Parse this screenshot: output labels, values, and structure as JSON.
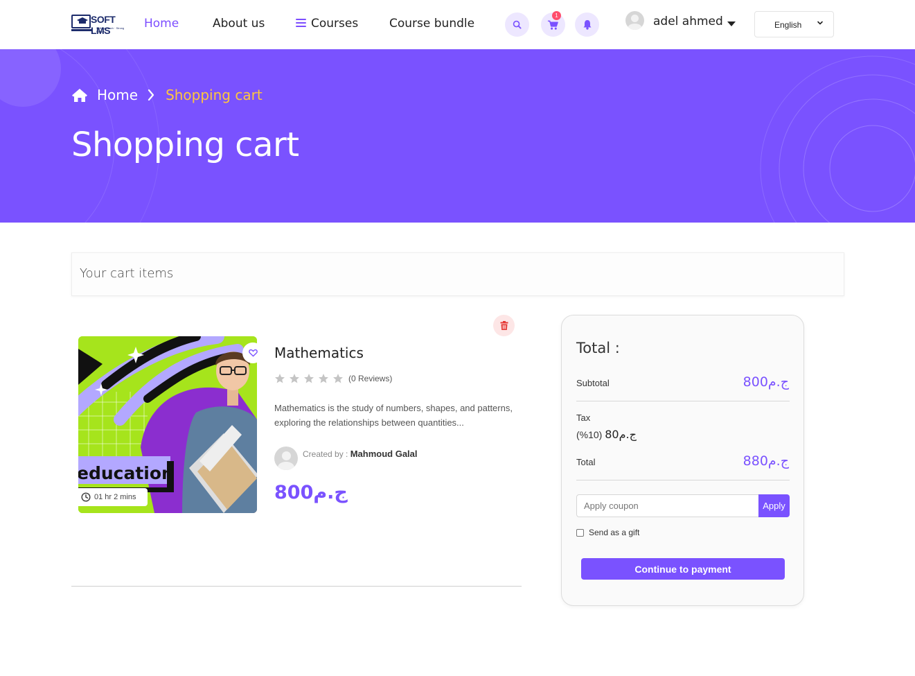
{
  "colors": {
    "accent": "#7a52ff",
    "breadcrumb_current": "#ffc63d",
    "danger": "#e53935",
    "badge": "#ff4d6d"
  },
  "header": {
    "logo_text": "SOFT LMS",
    "logo_tagline": "Soft approach · Strong Results",
    "nav": {
      "home": "Home",
      "about": "About us",
      "courses": "Courses",
      "bundle": "Course bundle"
    },
    "cart_count": "1",
    "user_name": "adel ahmed",
    "language": "English",
    "icons": [
      "search-icon",
      "cart-icon",
      "bell-icon",
      "avatar",
      "caret-down-icon",
      "chevron-down-icon"
    ]
  },
  "banner": {
    "breadcrumb": {
      "home": "Home",
      "current": "Shopping cart"
    },
    "title": "Shopping cart"
  },
  "cart": {
    "section_title": "Your cart items",
    "items": [
      {
        "title": "Mathematics",
        "rating": 0,
        "reviews": "(0 Reviews)",
        "description": "Mathematics is the study of numbers, shapes, and patterns, exploring the relationships between quantities...",
        "created_by_label": "Created by :",
        "author": "Mahmoud Galal",
        "price": "800ج.م",
        "duration": "01 hr 2 mins",
        "thumbnail_text": "education"
      }
    ]
  },
  "summary": {
    "title": "Total :",
    "subtotal_label": "Subtotal",
    "subtotal_value": "800ج.م",
    "tax_label": "Tax",
    "tax_rate": "(%10)",
    "tax_amount": "80ج.م",
    "total_label": "Total",
    "total_value": "880ج.م",
    "coupon_placeholder": "Apply coupon",
    "coupon_value": "",
    "apply_label": "Apply",
    "gift_label": "Send as a gift",
    "gift_checked": false,
    "pay_label": "Continue to payment"
  }
}
